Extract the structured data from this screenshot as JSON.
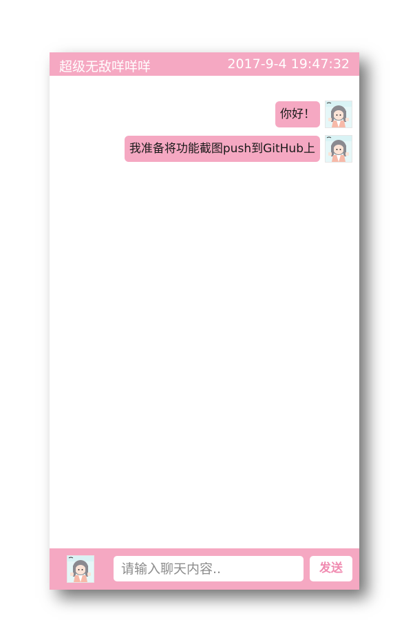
{
  "header": {
    "contact_name": "超级无敌咩咩咩",
    "timestamp": "2017-9-4 19:47:32"
  },
  "messages": [
    {
      "text": "你好！",
      "side": "right",
      "avatar": "girl-avatar-icon"
    },
    {
      "text": "我准备将功能截图push到GitHub上",
      "side": "right",
      "avatar": "girl-avatar-icon"
    }
  ],
  "composer": {
    "placeholder": "请输入聊天内容..",
    "value": "",
    "send_label": "发送",
    "avatar": "girl-avatar-icon"
  },
  "colors": {
    "accent": "#f5a8c2",
    "send_text": "#f08ab0",
    "background": "#ffffff"
  }
}
